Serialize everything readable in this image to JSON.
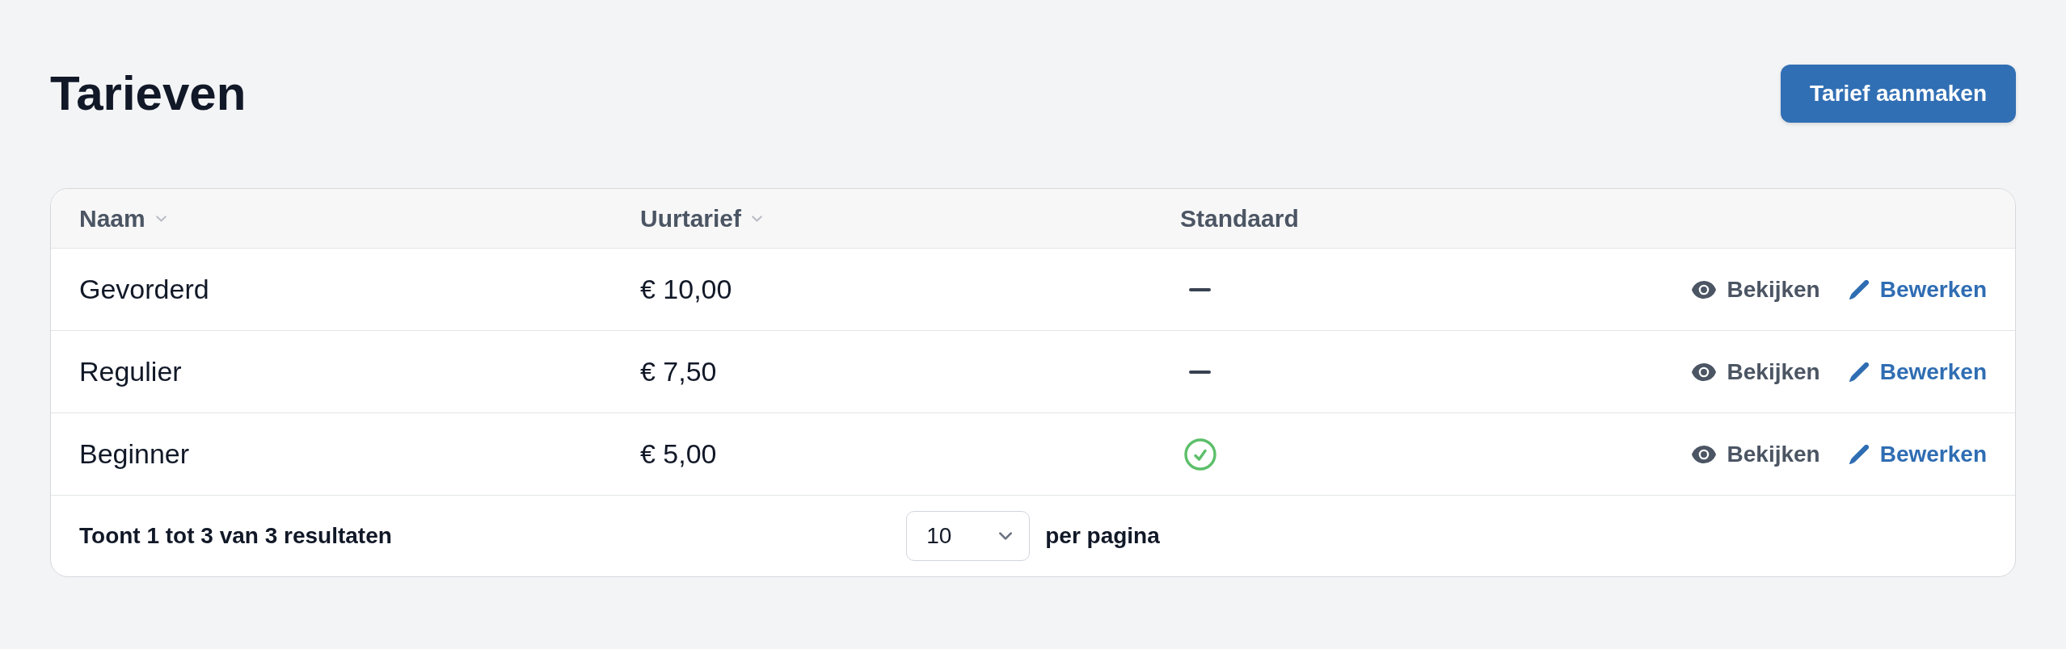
{
  "page": {
    "title": "Tarieven",
    "create_button": "Tarief aanmaken"
  },
  "table": {
    "columns": [
      {
        "label": "Naam",
        "sortable": true
      },
      {
        "label": "Uurtarief",
        "sortable": true
      },
      {
        "label": "Standaard",
        "sortable": false
      }
    ],
    "rows": [
      {
        "naam": "Gevorderd",
        "uurtarief": "€ 10,00",
        "default": false,
        "actions": [
          {
            "kind": "view",
            "label": "Bekijken"
          },
          {
            "kind": "edit",
            "label": "Bewerken"
          }
        ]
      },
      {
        "naam": "Regulier",
        "uurtarief": "€ 7,50",
        "default": false,
        "actions": [
          {
            "kind": "view",
            "label": "Bekijken"
          },
          {
            "kind": "edit",
            "label": "Bewerken"
          }
        ]
      },
      {
        "naam": "Beginner",
        "uurtarief": "€ 5,00",
        "default": true,
        "actions": [
          {
            "kind": "view",
            "label": "Bekijken"
          },
          {
            "kind": "edit",
            "label": "Bewerken"
          }
        ]
      }
    ],
    "footer": {
      "summary": "Toont 1 tot 3 van 3 resultaten",
      "per_page": {
        "value": "10",
        "label": "per pagina"
      }
    }
  }
}
